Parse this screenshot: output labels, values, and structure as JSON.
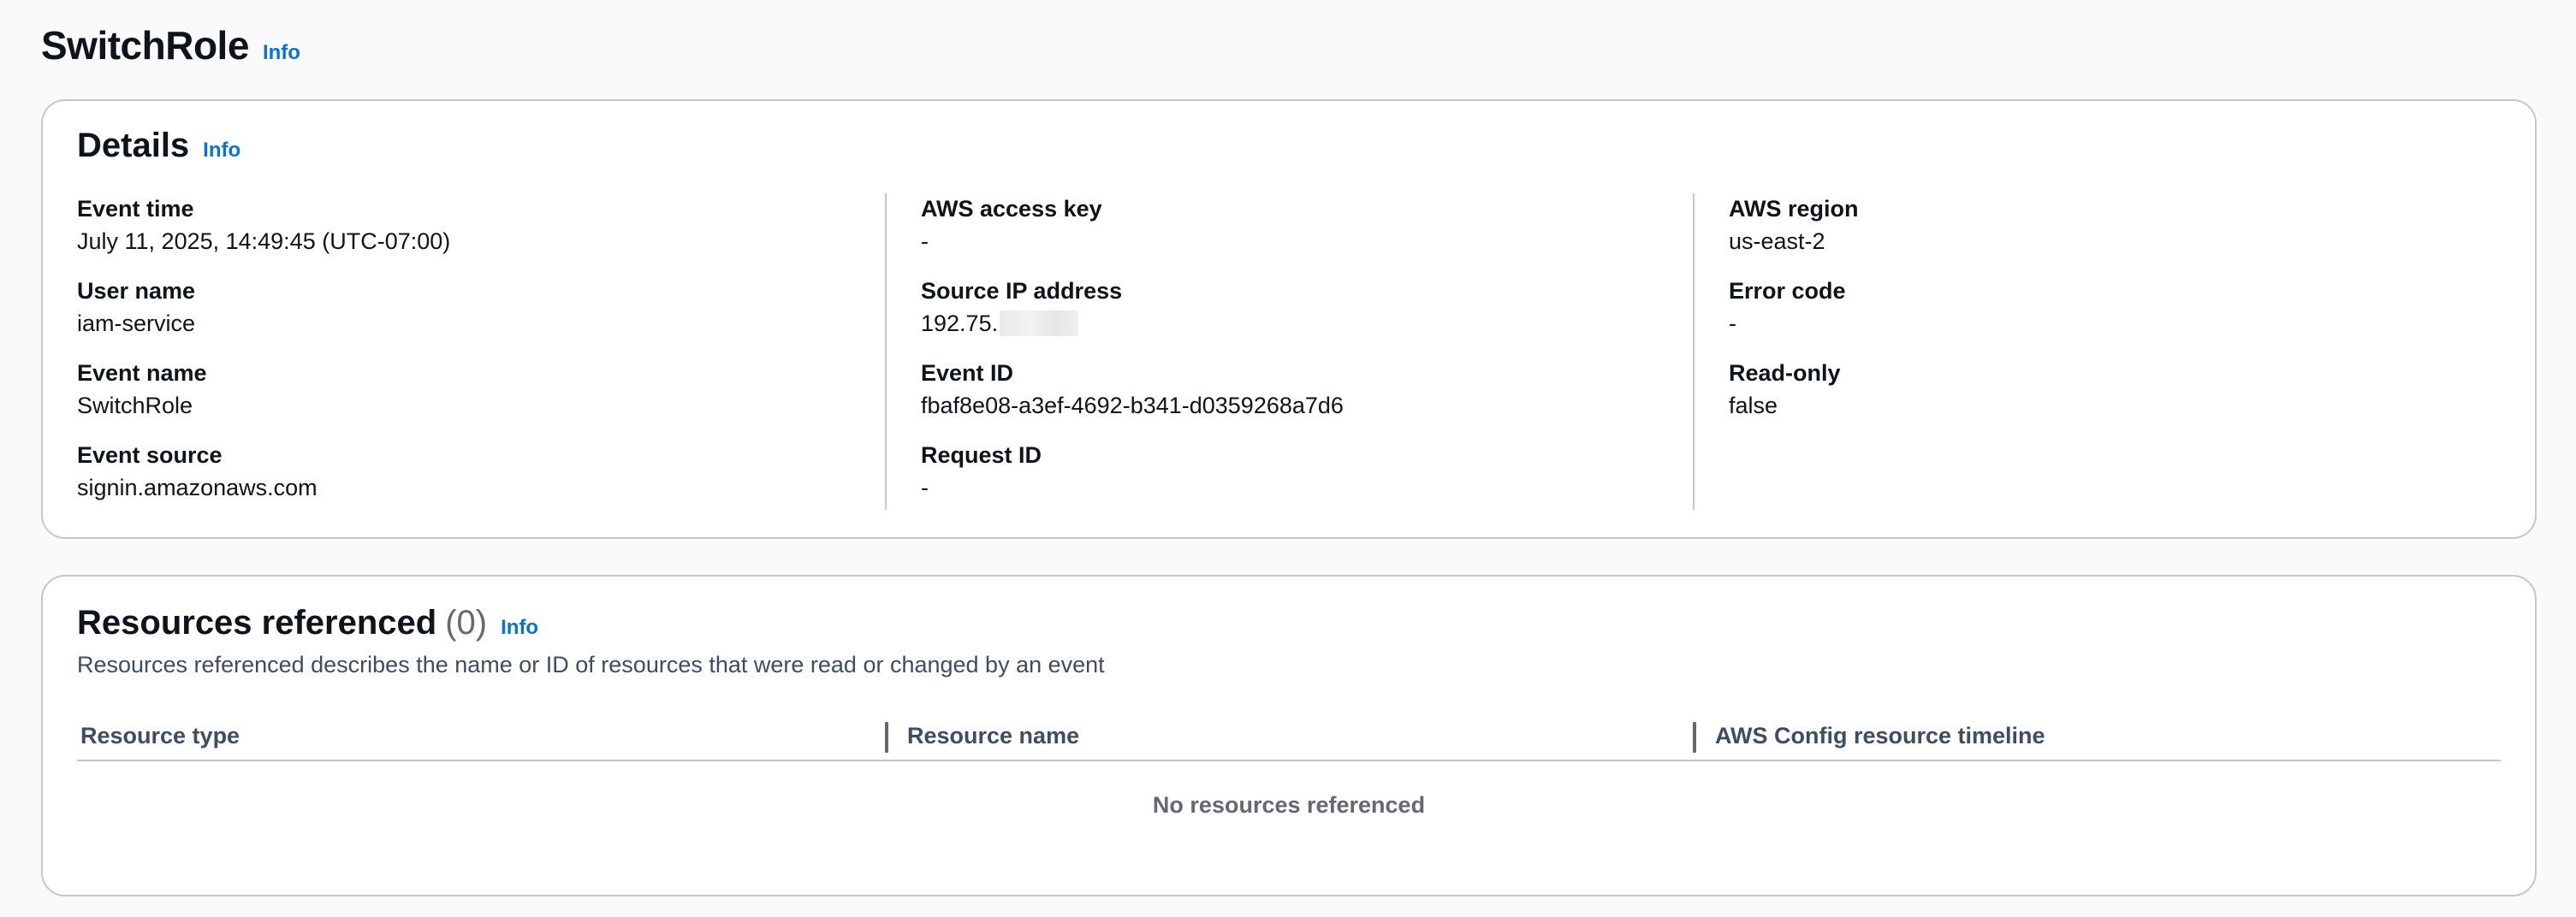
{
  "page": {
    "title": "SwitchRole",
    "info_label": "Info"
  },
  "details": {
    "title": "Details",
    "info_label": "Info",
    "fields": {
      "event_time": {
        "label": "Event time",
        "value": "July 11, 2025, 14:49:45 (UTC-07:00)"
      },
      "user_name": {
        "label": "User name",
        "value": "iam-service"
      },
      "event_name": {
        "label": "Event name",
        "value": "SwitchRole"
      },
      "event_source": {
        "label": "Event source",
        "value": "signin.amazonaws.com"
      },
      "access_key": {
        "label": "AWS access key",
        "value": "-"
      },
      "source_ip": {
        "label": "Source IP address",
        "value": "192.75."
      },
      "event_id": {
        "label": "Event ID",
        "value": "fbaf8e08-a3ef-4692-b341-d0359268a7d6"
      },
      "request_id": {
        "label": "Request ID",
        "value": "-"
      },
      "region": {
        "label": "AWS region",
        "value": "us-east-2"
      },
      "error_code": {
        "label": "Error code",
        "value": "-"
      },
      "read_only": {
        "label": "Read-only",
        "value": "false"
      }
    }
  },
  "resources": {
    "title": "Resources referenced",
    "count": "(0)",
    "info_label": "Info",
    "description": "Resources referenced describes the name or ID of resources that were read or changed by an event",
    "columns": [
      "Resource type",
      "Resource name",
      "AWS Config resource timeline"
    ],
    "empty_message": "No resources referenced"
  },
  "colors": {
    "link": "#0972d3",
    "border": "#c6c6cd",
    "text": "#0f141a",
    "muted": "#656871"
  }
}
